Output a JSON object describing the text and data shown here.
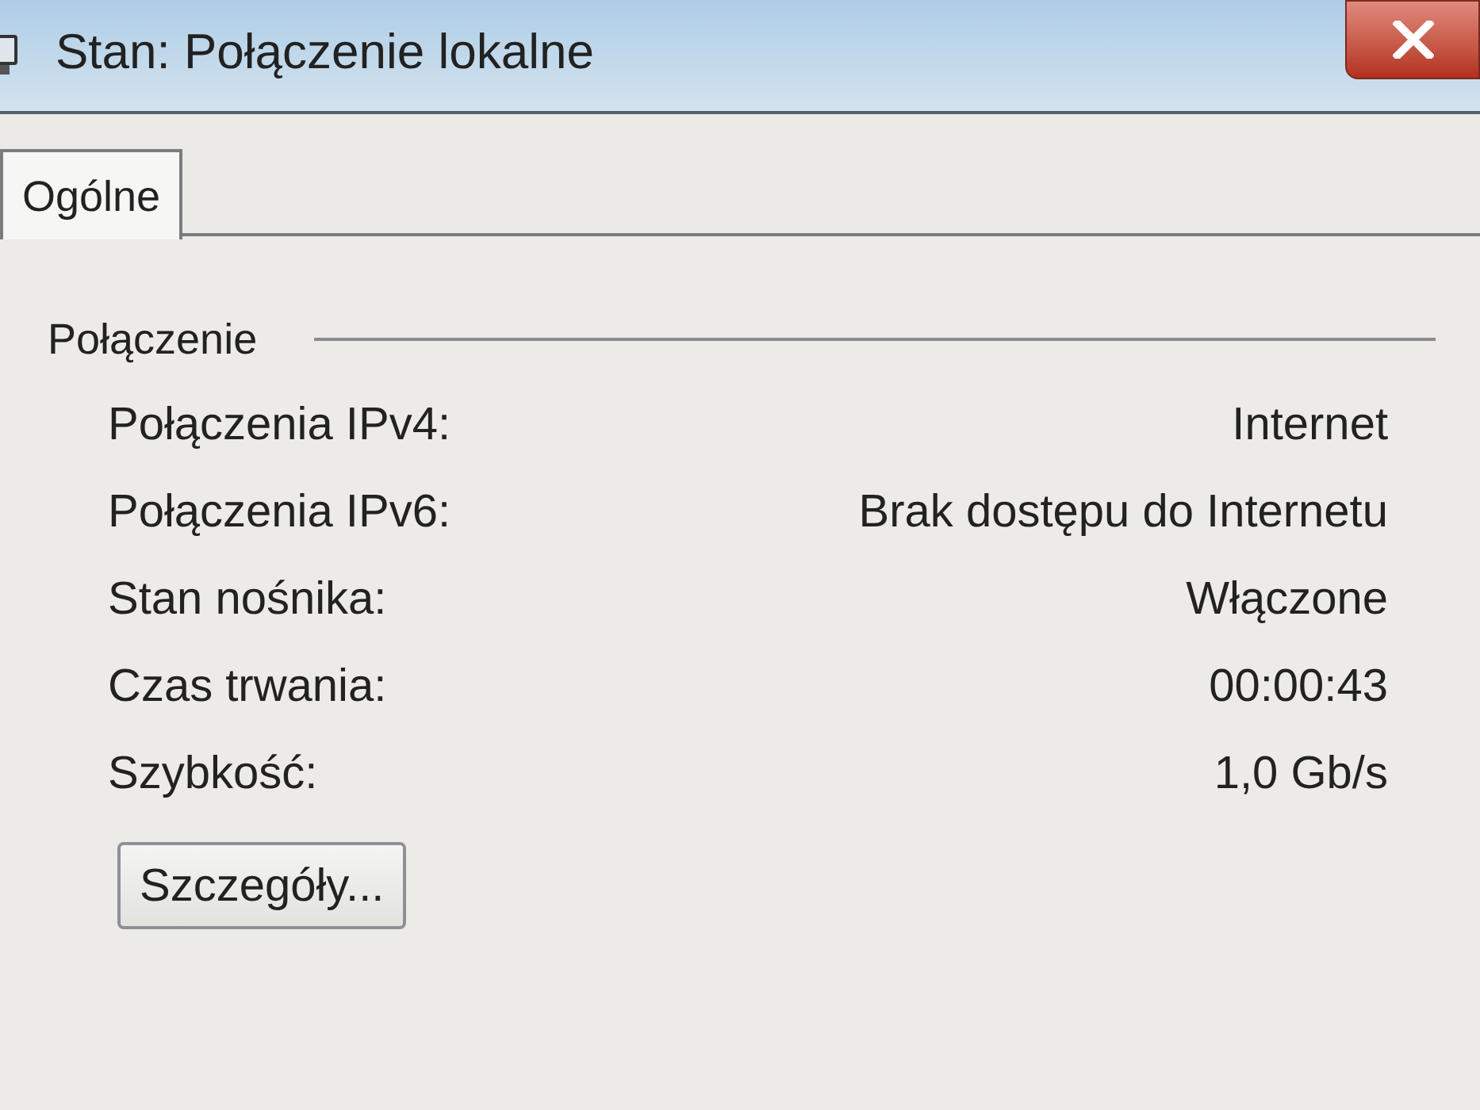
{
  "window": {
    "title": "Stan: Połączenie lokalne"
  },
  "tabs": [
    {
      "label": "Ogólne",
      "selected": true
    }
  ],
  "group": {
    "title": "Połączenie",
    "rows": [
      {
        "label": "Połączenia IPv4:",
        "value": "Internet"
      },
      {
        "label": "Połączenia IPv6:",
        "value": "Brak dostępu do Internetu"
      },
      {
        "label": "Stan nośnika:",
        "value": "Włączone"
      },
      {
        "label": "Czas trwania:",
        "value": "00:00:43"
      },
      {
        "label": "Szybkość:",
        "value": "1,0 Gb/s"
      }
    ]
  },
  "buttons": [
    "Szczegóły..."
  ]
}
